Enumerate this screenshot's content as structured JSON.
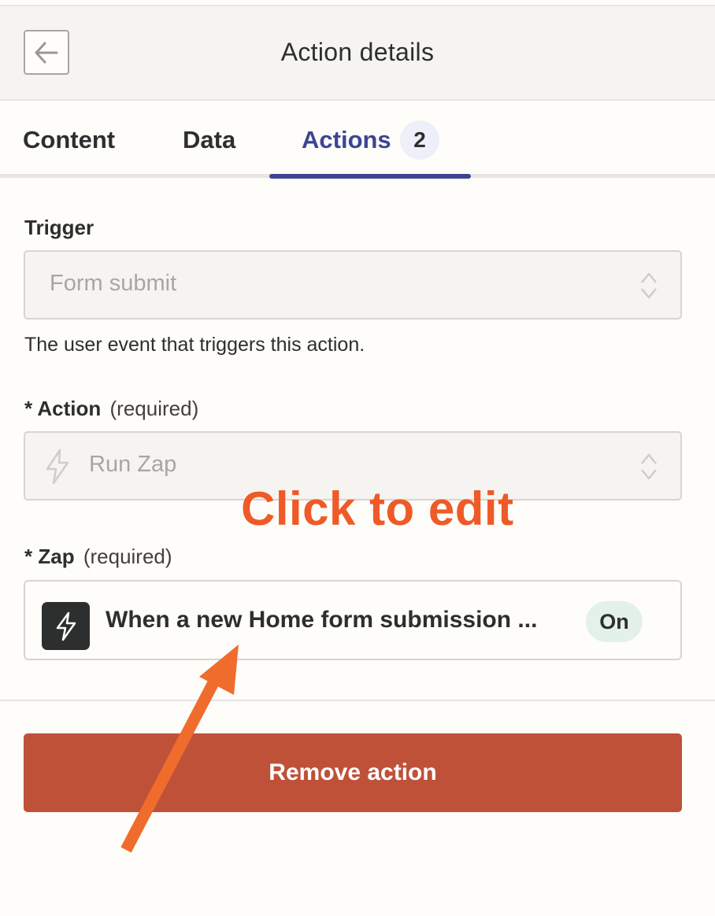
{
  "header": {
    "title": "Action details",
    "back_icon": "arrow-left-icon"
  },
  "tabs": [
    {
      "label": "Content",
      "active": false
    },
    {
      "label": "Data",
      "active": false
    },
    {
      "label": "Actions",
      "active": true,
      "count": "2"
    }
  ],
  "trigger": {
    "label": "Trigger",
    "value": "Form submit",
    "help": "The user event that triggers this action.",
    "icon": "chevron-up-down-icon"
  },
  "action": {
    "required_mark": "*",
    "label": "Action",
    "required_text": "(required)",
    "value": "Run Zap",
    "value_icon": "lightning-bolt-icon"
  },
  "zap": {
    "required_mark": "*",
    "label": "Zap",
    "required_text": "(required)",
    "name": "When a new Home form submission ...",
    "status": "On",
    "icon": "lightning-bolt-icon"
  },
  "remove_button": {
    "label": "Remove action"
  },
  "annotation": {
    "text": "Click to edit",
    "color": "#ee5a28"
  },
  "colors": {
    "accent": "#3d4592",
    "danger": "#bf5139",
    "status_on_bg": "#e3f1ea",
    "arrow": "#ef6c2d"
  }
}
